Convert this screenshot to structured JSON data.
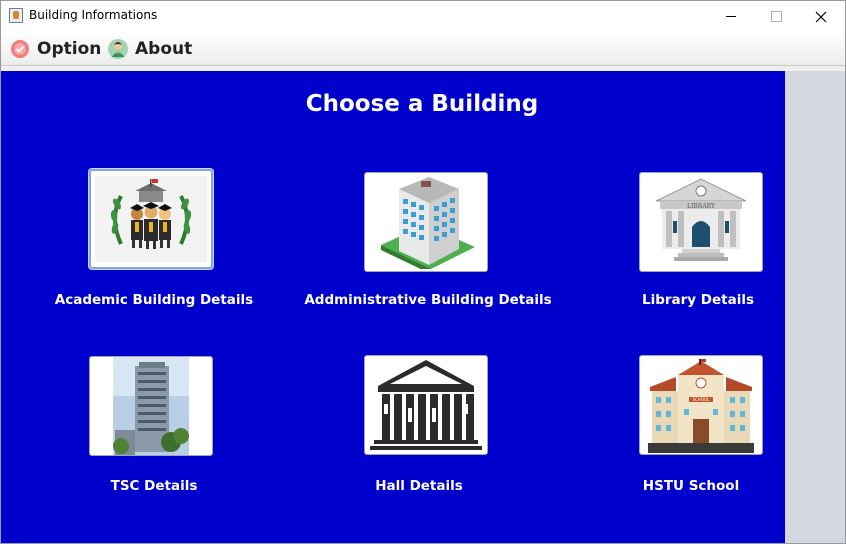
{
  "window": {
    "title": "Building Informations",
    "controls": [
      "minimize",
      "maximize",
      "close"
    ]
  },
  "menu": {
    "items": [
      {
        "label": "Option",
        "icon": "badge-check-icon"
      },
      {
        "label": "About",
        "icon": "person-avatar-icon"
      }
    ]
  },
  "main": {
    "heading": "Choose a Building",
    "buildings": [
      {
        "label": "Academic Building Details",
        "icon": "graduates-laurel-icon",
        "selected": true
      },
      {
        "label": "Addministrative Building Details",
        "icon": "office-tower-icon"
      },
      {
        "label": "Library Details",
        "icon": "library-building-icon"
      },
      {
        "label": "TSC Details",
        "icon": "high-rise-photo-icon"
      },
      {
        "label": "Hall Details",
        "icon": "columned-hall-icon"
      },
      {
        "label": "HSTU School",
        "icon": "school-building-icon"
      }
    ]
  },
  "colors": {
    "content_bg": "#0000cd",
    "side_panel": "#d4d7e0",
    "text": "#ffffff"
  }
}
